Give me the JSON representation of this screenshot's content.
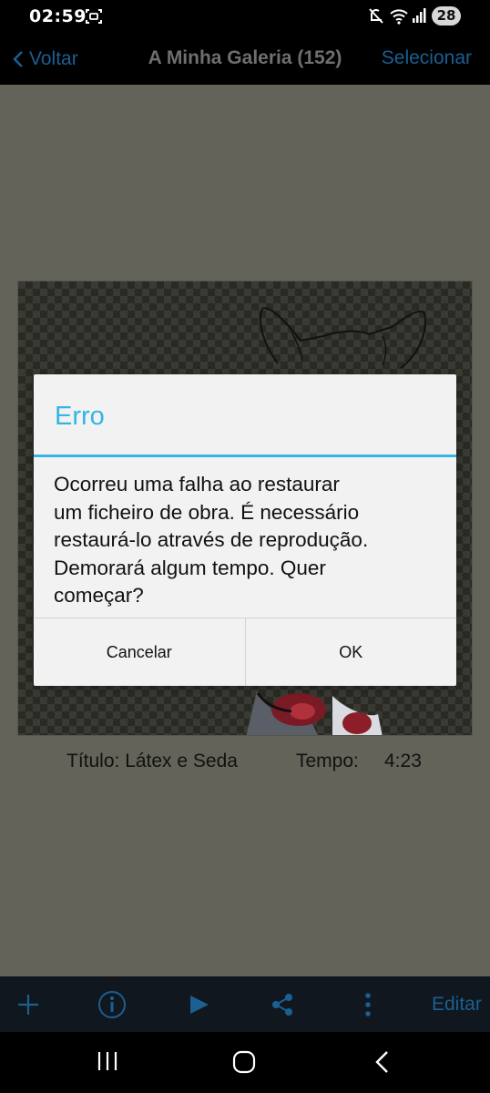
{
  "status_bar": {
    "time": "02:59",
    "battery": "28",
    "icons": [
      "screenshot-icon",
      "mute-icon",
      "wifi-icon",
      "signal-icon"
    ]
  },
  "header": {
    "back_label": "Voltar",
    "title": "A Minha Galeria (152)",
    "select_label": "Selecionar"
  },
  "artwork_info": {
    "title_label": "Título: Látex e Seda",
    "time_label": "Tempo:",
    "time_value": "4:23"
  },
  "dialog": {
    "title": "Erro",
    "message_lines": [
      "Ocorreu uma falha ao restaurar",
      "um ficheiro de obra. É necessário",
      "restaurá-lo através de reprodução.",
      "Demorará algum tempo. Quer",
      "começar?"
    ],
    "cancel_label": "Cancelar",
    "ok_label": "OK"
  },
  "toolbar": {
    "icons": [
      "add-icon",
      "info-icon",
      "play-icon",
      "share-icon",
      "more-icon"
    ],
    "edit_label": "Editar"
  },
  "navigation": {
    "icons": [
      "recent-apps-icon",
      "home-icon",
      "back-icon"
    ]
  },
  "colors": {
    "accent": "#33b5e5",
    "link_blue": "#1b5f93",
    "overlay_bg": "#636359",
    "toolbar_bg": "#10171e"
  }
}
